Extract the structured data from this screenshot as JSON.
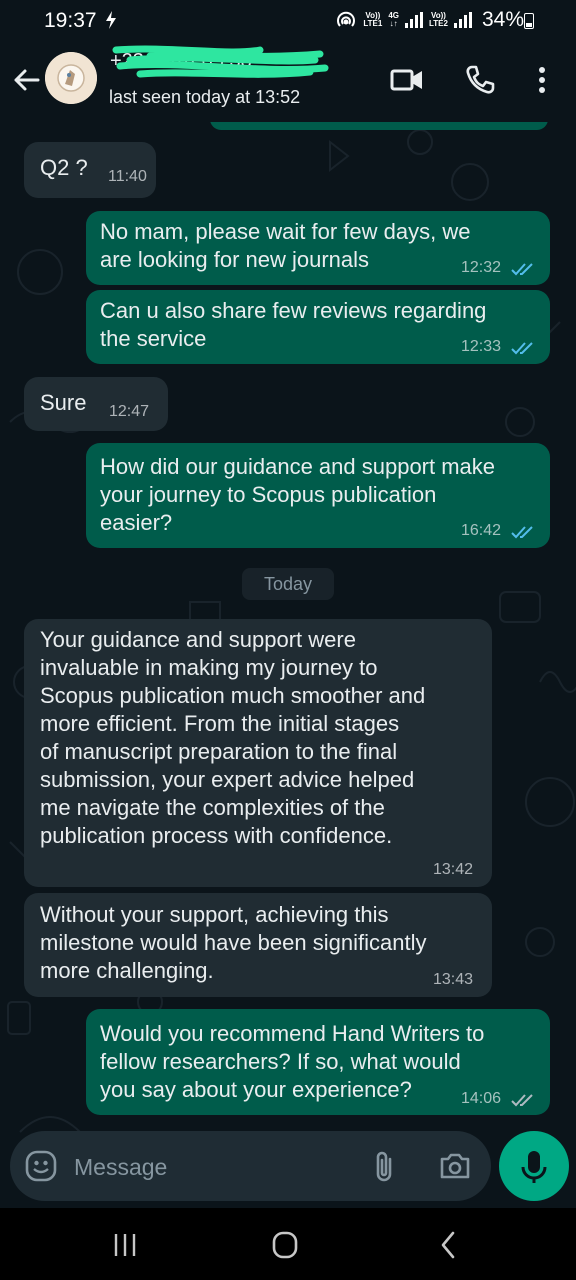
{
  "status_bar": {
    "time": "19:37",
    "notification_icon": "dollar-notification-icon",
    "sim1_label": "Vo))",
    "sim1_sub": "LTE1",
    "network": "4G",
    "sim2_label": "Vo))",
    "sim2_sub": "LTE2",
    "battery": "34%"
  },
  "header": {
    "contact_name_redacted": "+23·· ····· 05 38",
    "last_seen": "last seen today at 13:52",
    "icons": [
      "back-arrow-icon",
      "video-call-icon",
      "voice-call-icon",
      "more-options-icon"
    ]
  },
  "messages": [
    {
      "direction": "in",
      "text": "Q2 ?",
      "time": "11:40"
    },
    {
      "direction": "out",
      "text": "No mam, please wait for few days, we\nare looking for new journals",
      "time": "12:32",
      "status": "read"
    },
    {
      "direction": "out",
      "text": "Can u also share few reviews regarding\nthe service",
      "time": "12:33",
      "status": "read"
    },
    {
      "direction": "in",
      "text": "Sure",
      "time": "12:47"
    },
    {
      "direction": "out",
      "text": "How did our guidance and support make\nyour journey to Scopus publication\neasier?",
      "time": "16:42",
      "status": "read"
    },
    {
      "direction": "in",
      "text": "Your guidance and support were\ninvaluable in making my journey to\nScopus publication much smoother and\nmore efficient. From the initial stages\nof manuscript preparation to the final\nsubmission, your expert advice helped\nme navigate the complexities of the\npublication process with confidence.",
      "time": "13:42"
    },
    {
      "direction": "in",
      "text": "Without your support, achieving this\nmilestone would have been significantly\nmore challenging.",
      "time": "13:43"
    },
    {
      "direction": "out",
      "text": "Would you recommend Hand Writers to\nfellow researchers? If so, what would\nyou say about your experience?",
      "time": "14:06",
      "status": "delivered"
    }
  ],
  "date_separator": "Today",
  "composer": {
    "placeholder": "Message",
    "icons": [
      "emoji-icon",
      "attach-icon",
      "camera-icon",
      "mic-icon"
    ]
  },
  "colors": {
    "background": "#0b141a",
    "incoming_bubble": "#202c33",
    "outgoing_bubble": "#005c4b",
    "read_tick": "#53bdeb",
    "accent": "#00a884"
  },
  "nav_bar": {
    "icons": [
      "recent-apps-icon",
      "home-icon",
      "back-nav-icon"
    ]
  }
}
